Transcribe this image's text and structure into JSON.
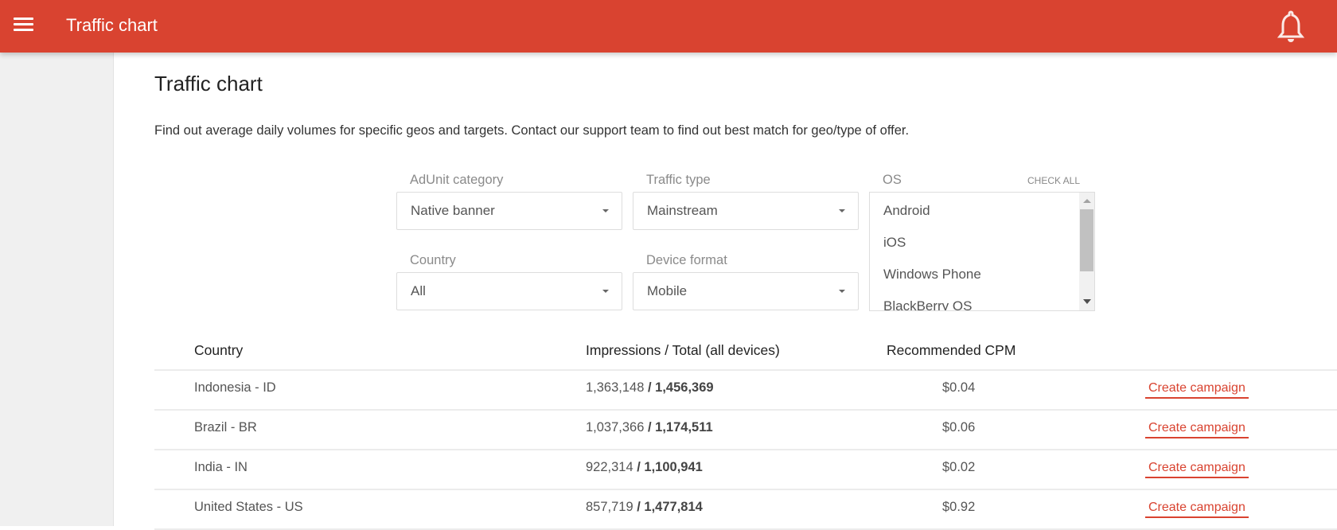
{
  "header": {
    "title": "Traffic chart",
    "menu_icon": "hamburger-menu-icon",
    "notification_icon": "bell-icon",
    "color": "#d94330"
  },
  "page": {
    "title": "Traffic chart",
    "description": "Find out average daily volumes for specific geos and targets. Contact our support team to find out best match for geo/type of offer."
  },
  "filters": {
    "adunit": {
      "label": "AdUnit category",
      "value": "Native banner"
    },
    "traffic": {
      "label": "Traffic type",
      "value": "Mainstream"
    },
    "country": {
      "label": "Country",
      "value": "All"
    },
    "device": {
      "label": "Device format",
      "value": "Mobile"
    },
    "os": {
      "label": "OS",
      "check_all": "CHECK ALL",
      "options": [
        "Android",
        "iOS",
        "Windows Phone",
        "BlackBerry OS"
      ]
    }
  },
  "table": {
    "headers": [
      "Country",
      "Impressions / Total (all devices)",
      "Recommended CPM"
    ],
    "rows": [
      {
        "country": "Indonesia - ID",
        "impressions": "1,363,148",
        "sep": " / ",
        "total": "1,456,369",
        "cpm": "$0.04",
        "action": "Create campaign"
      },
      {
        "country": "Brazil - BR",
        "impressions": "1,037,366",
        "sep": " / ",
        "total": "1,174,511",
        "cpm": "$0.06",
        "action": "Create campaign"
      },
      {
        "country": "India - IN",
        "impressions": "922,314",
        "sep": " / ",
        "total": "1,100,941",
        "cpm": "$0.02",
        "action": "Create campaign"
      },
      {
        "country": "United States - US",
        "impressions": "857,719",
        "sep": " / ",
        "total": "1,477,814",
        "cpm": "$0.92",
        "action": "Create campaign"
      }
    ]
  }
}
